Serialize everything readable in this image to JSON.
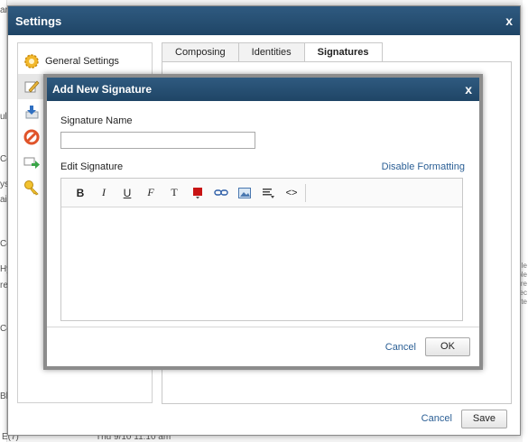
{
  "background": {
    "left_fragments": [
      "ar",
      "ule",
      "Co",
      "ys",
      "ail",
      "Co",
      "Hy",
      "re",
      "Co",
      "Bl"
    ],
    "right_fragments": [
      "le",
      "ple",
      "re",
      "rec",
      "ite"
    ],
    "bottom_left": "E(7)",
    "bottom_timestamp": "Thu 9/10 11:10 am"
  },
  "settings": {
    "title": "Settings",
    "close_glyph": "x",
    "nav": [
      {
        "label": "General Settings",
        "icon": "gear-icon"
      },
      {
        "label": "",
        "icon": "compose-icon"
      },
      {
        "label": "",
        "icon": "download-arrow-icon"
      },
      {
        "label": "",
        "icon": "block-icon"
      },
      {
        "label": "",
        "icon": "forward-mail-icon"
      },
      {
        "label": "",
        "icon": "key-icon"
      }
    ],
    "tabs": [
      {
        "label": "Composing"
      },
      {
        "label": "Identities"
      },
      {
        "label": "Signatures"
      }
    ],
    "cancel_label": "Cancel",
    "save_label": "Save"
  },
  "signature_dialog": {
    "title": "Add New Signature",
    "close_glyph": "x",
    "name_label": "Signature Name",
    "name_value": "",
    "edit_label": "Edit Signature",
    "disable_formatting_label": "Disable Formatting",
    "toolbar": {
      "bold": "B",
      "italic": "I",
      "underline": "U",
      "font_family": "F",
      "font_size": "T",
      "link": "∞",
      "code": "<>"
    },
    "cancel_label": "Cancel",
    "ok_label": "OK"
  },
  "colors": {
    "titlebar": "#1f4566",
    "link": "#2b5f95",
    "text_color_swatch": "#c81414"
  }
}
